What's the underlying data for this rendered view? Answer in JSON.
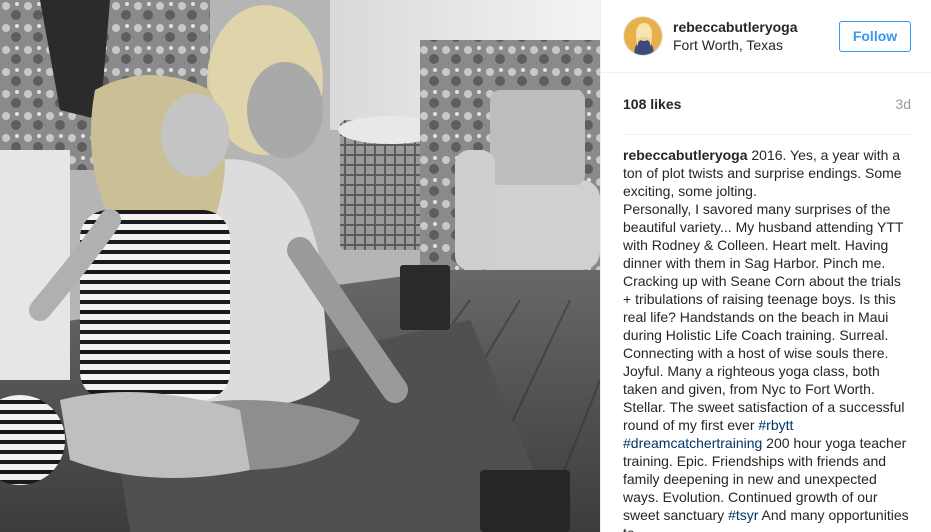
{
  "post": {
    "username": "rebeccabutleryoga",
    "location": "Fort Worth, Texas",
    "follow_label": "Follow",
    "likes": "108 likes",
    "age": "3d"
  },
  "caption": {
    "username": "rebeccabutleryoga",
    "line1": " 2016. Yes, a year with a ton of plot twists and surprise endings. Some exciting, some jolting.",
    "p2_before_tag1": "Personally, I savored many surprises of the beautiful variety... My husband attending YTT with Rodney & Colleen. Heart melt. Having dinner with them in Sag Harbor. Pinch me. Cracking up with Seane Corn about the trials + tribulations of raising teenage boys. Is this real life? Handstands on the beach in Maui during Holistic Life Coach training. Surreal. Connecting with a host of wise souls there. Joyful. Many a righteous yoga class, both taken and given, from Nyc to Fort Worth. Stellar. The sweet satisfaction of a successful round of my first ever ",
    "tag1": "#rbytt",
    "tag2": "#dreamcatchertraining",
    "p2_after_tag2": " 200 hour yoga teacher training. Epic. Friendships with friends and family deepening in new and unexpected ways. Evolution. Continued growth of our sweet sanctuary ",
    "tag3": "#tsyr",
    "p2_end": " And many opportunities to"
  },
  "colors": {
    "follow_blue": "#3897f0",
    "hashtag": "#003569",
    "muted": "#999999",
    "text": "#262626"
  }
}
